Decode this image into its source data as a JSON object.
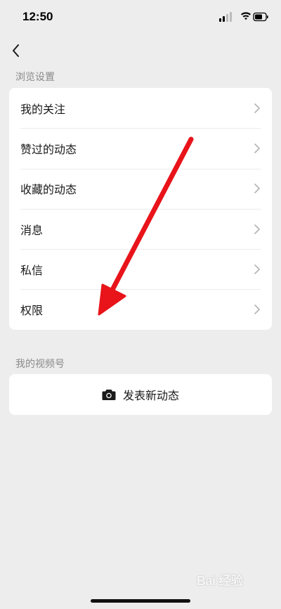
{
  "status_bar": {
    "time": "12:50",
    "icons": [
      "signal-icon",
      "wifi-icon",
      "battery-icon"
    ]
  },
  "nav": {
    "back_icon": "chevron-left-icon"
  },
  "browse_settings": {
    "section_title": "浏览设置",
    "items": [
      {
        "label": "我的关注"
      },
      {
        "label": "赞过的动态"
      },
      {
        "label": "收藏的动态"
      },
      {
        "label": "消息"
      },
      {
        "label": "私信"
      },
      {
        "label": "权限"
      }
    ]
  },
  "channel": {
    "section_title": "我的视频号",
    "post_button_label": "发表新动态",
    "post_icon": "camera-icon"
  },
  "annotation": {
    "type": "red-arrow",
    "points_to": "权限",
    "color": "#e8141a"
  },
  "watermark": {
    "text": "Bai 经验",
    "icon": "baidu-paw-icon"
  }
}
